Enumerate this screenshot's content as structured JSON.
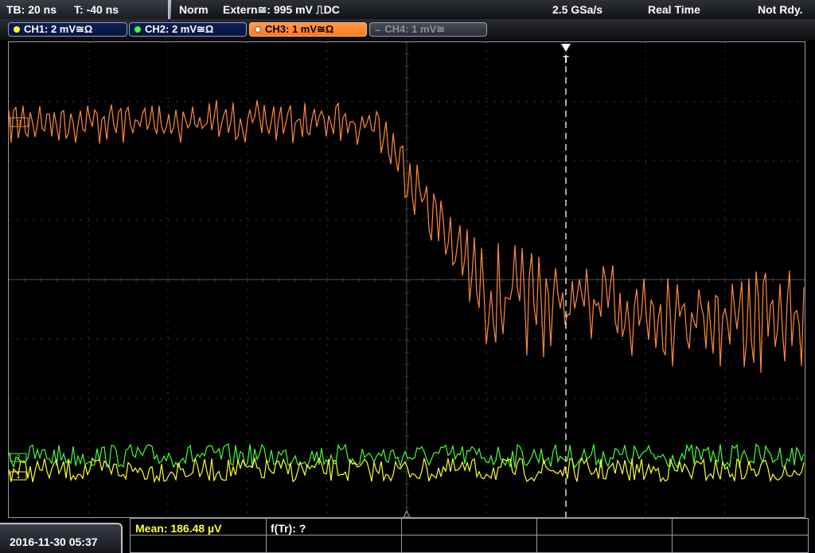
{
  "topbar": {
    "timebase": "TB: 20 ns",
    "trigger_offset": "T: -40 ns",
    "mode": "Norm",
    "trigger_source": "Extern≅: 995 mV ⎍DC",
    "sample_rate": "2.5 GSa/s",
    "acquisition": "Real Time",
    "status": "Not Rdy."
  },
  "channels": [
    {
      "label": "CH1: 2 mV≅Ω",
      "color": "#ffff33",
      "state": "on"
    },
    {
      "label": "CH2: 2 mV≅Ω",
      "color": "#44ff33",
      "state": "on"
    },
    {
      "label": "CH3: 1 mV≅Ω",
      "color": "#ff8a3c",
      "state": "active"
    },
    {
      "label": "CH4: 1 mV≅",
      "color": "#8c8e96",
      "state": "off"
    }
  ],
  "markers": {
    "ch3_ref": "3",
    "ch2_ref": "2",
    "ch1_ref": "1",
    "trigger": "T"
  },
  "footer": {
    "datetime": "2016-11-30 05:37",
    "mean": "Mean: 186.48 µV",
    "ftr": "f(Tr): ?"
  },
  "colors": {
    "ch1": "#ffff33",
    "ch2": "#44ff33",
    "ch3": "#ff8a3c",
    "grid": "#3c3c3c"
  }
}
